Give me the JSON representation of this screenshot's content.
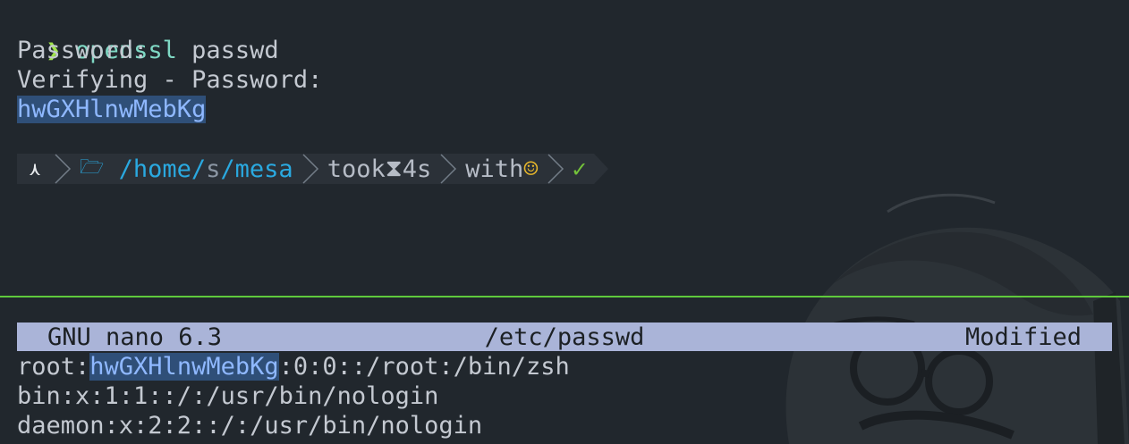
{
  "prompt": {
    "symbol": "❯",
    "command": "openssl",
    "argument": "passwd"
  },
  "output": {
    "password_prompt": "Password:",
    "verify_prompt": "Verifying - Password:",
    "hash": "hwGXHlnwMebKg"
  },
  "powerline": {
    "os_icon": "⋏",
    "folder_icon": "🗁",
    "path": [
      {
        "text": "/home/",
        "style": "blue"
      },
      {
        "text": "s",
        "style": "grey"
      },
      {
        "text": "/mesa",
        "style": "blue"
      }
    ],
    "took_label": "took",
    "hourglass_icon": "⧗",
    "duration": "4s",
    "with_label": "with",
    "smile_icon": "☺",
    "check_icon": "✓"
  },
  "nano": {
    "version_label": "GNU nano 6.3",
    "filename": "/etc/passwd",
    "status": "Modified",
    "lines": [
      {
        "prefix": "root:",
        "highlight": "hwGXHlnwMebKg",
        "suffix": ":0:0::/root:/bin/zsh"
      },
      {
        "prefix": "bin:x:1:1::/:/usr/bin/nologin",
        "highlight": "",
        "suffix": ""
      },
      {
        "prefix": "daemon:x:2:2::/:/usr/bin/nologin",
        "highlight": "",
        "suffix": ""
      }
    ]
  },
  "colors": {
    "background": "#21272d",
    "split_line": "#5fca3c",
    "titlebar": "#aab4d8",
    "highlight": "#2f4f78"
  }
}
